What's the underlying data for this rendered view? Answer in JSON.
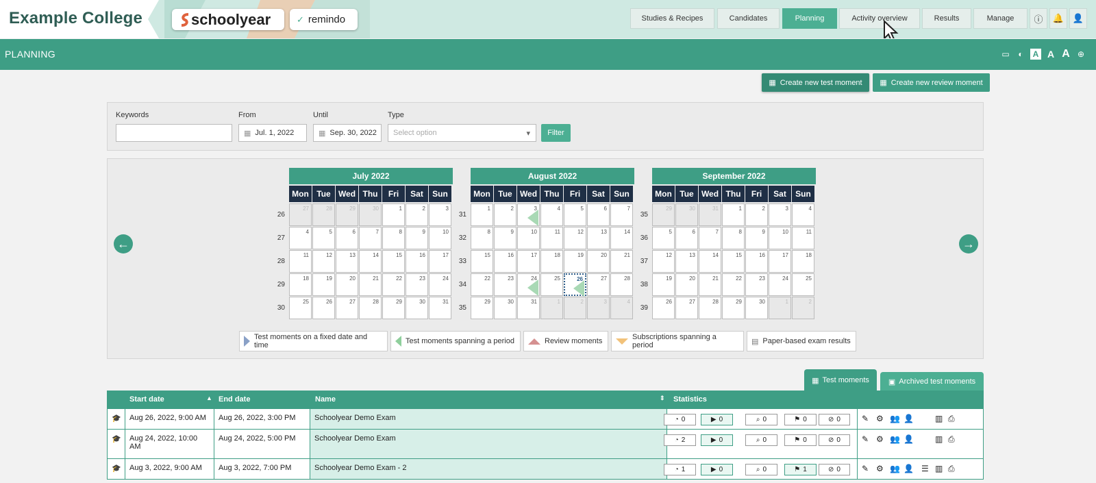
{
  "header": {
    "college": "Example College",
    "brand_schoolyear": "schoolyear",
    "brand_remindo": "remindo",
    "nav": [
      "Studies & Recipes",
      "Candidates",
      "Planning",
      "Activity overview",
      "Results",
      "Manage"
    ],
    "active_nav": "Planning"
  },
  "page": {
    "title": "PLANNING",
    "create_test_label": "Create new test moment",
    "create_review_label": "Create new review moment"
  },
  "filter": {
    "keywords_label": "Keywords",
    "keywords_value": "",
    "from_label": "From",
    "from_value": "Jul. 1, 2022",
    "until_label": "Until",
    "until_value": "Sep. 30, 2022",
    "type_label": "Type",
    "type_placeholder": "Select option",
    "filter_button": "Filter"
  },
  "calendar": {
    "weekdays": [
      "Mon",
      "Tue",
      "Wed",
      "Thu",
      "Fri",
      "Sat",
      "Sun"
    ],
    "months": [
      {
        "name": "July 2022",
        "weeks": [
          "26",
          "27",
          "28",
          "29",
          "30"
        ],
        "days": [
          [
            "27",
            "28",
            "29",
            "30",
            "1",
            "2",
            "3"
          ],
          [
            "4",
            "5",
            "6",
            "7",
            "8",
            "9",
            "10"
          ],
          [
            "11",
            "12",
            "13",
            "14",
            "15",
            "16",
            "17"
          ],
          [
            "18",
            "19",
            "20",
            "21",
            "22",
            "23",
            "24"
          ],
          [
            "25",
            "26",
            "27",
            "28",
            "29",
            "30",
            "31"
          ]
        ],
        "other": [
          [
            0,
            1,
            2,
            3
          ]
        ]
      },
      {
        "name": "August 2022",
        "weeks": [
          "31",
          "32",
          "33",
          "34",
          "35"
        ],
        "days": [
          [
            "1",
            "2",
            "3",
            "4",
            "5",
            "6",
            "7"
          ],
          [
            "8",
            "9",
            "10",
            "11",
            "12",
            "13",
            "14"
          ],
          [
            "15",
            "16",
            "17",
            "18",
            "19",
            "20",
            "21"
          ],
          [
            "22",
            "23",
            "24",
            "25",
            "26",
            "27",
            "28"
          ],
          [
            "29",
            "30",
            "31",
            "1",
            "2",
            "3",
            "4"
          ]
        ],
        "other": [
          [],
          [],
          [],
          [],
          [
            3,
            4,
            5,
            6
          ]
        ]
      },
      {
        "name": "September 2022",
        "weeks": [
          "35",
          "36",
          "37",
          "38",
          "39"
        ],
        "days": [
          [
            "29",
            "30",
            "31",
            "1",
            "2",
            "3",
            "4"
          ],
          [
            "5",
            "6",
            "7",
            "8",
            "9",
            "10",
            "11"
          ],
          [
            "12",
            "13",
            "14",
            "15",
            "16",
            "17",
            "18"
          ],
          [
            "19",
            "20",
            "21",
            "22",
            "23",
            "24",
            "25"
          ],
          [
            "26",
            "27",
            "28",
            "29",
            "30",
            "1",
            "2"
          ]
        ],
        "other": [
          [
            0,
            1,
            2
          ],
          [],
          [],
          [],
          [
            5,
            6
          ]
        ]
      }
    ],
    "legend": [
      "Test moments on a fixed date and time",
      "Test moments spanning a period",
      "Review moments",
      "Subscriptions spanning a period",
      "Paper-based exam results"
    ]
  },
  "tabs": {
    "test_moments": "Test moments",
    "archived": "Archived test moments"
  },
  "table": {
    "columns": [
      "Start date",
      "End date",
      "Name",
      "Statistics"
    ],
    "rows": [
      {
        "start": "Aug 26, 2022, 9:00 AM",
        "end": "Aug 26, 2022, 3:00 PM",
        "name": "Schoolyear Demo Exam",
        "stats": [
          "0",
          "0",
          "0",
          "0",
          "0"
        ]
      },
      {
        "start": "Aug 24, 2022, 10:00 AM",
        "end": "Aug 24, 2022, 5:00 PM",
        "name": "Schoolyear Demo Exam",
        "stats": [
          "2",
          "0",
          "0",
          "0",
          "0"
        ]
      },
      {
        "start": "Aug 3, 2022, 9:00 AM",
        "end": "Aug 3, 2022, 7:00 PM",
        "name": "Schoolyear Demo Exam - 2",
        "stats": [
          "1",
          "0",
          "0",
          "1",
          "0"
        ]
      }
    ]
  }
}
